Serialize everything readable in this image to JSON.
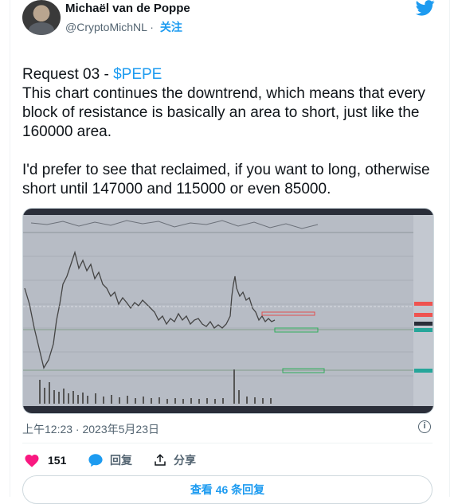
{
  "author": {
    "name": "Michaël van de Poppe",
    "handle": "@CryptoMichNL",
    "follow_label": "关注"
  },
  "tweet": {
    "line1_prefix": "Request 03 - ",
    "line1_cashtag": "$PEPE",
    "para2": "This chart continues the downtrend, which means that every block of resistance is basically an area to short, just like the 160000 area.",
    "para3": "I'd prefer to see that reclaimed, if you want to long, otherwise short until 147000 and 115000 or even 85000."
  },
  "meta": {
    "timestamp": "上午12:23 · 2023年5月23日",
    "info_label": "i"
  },
  "actions": {
    "likes": "151",
    "reply_label": "回复",
    "share_label": "分享"
  },
  "replies_button": "查看 46 条回复",
  "colors": {
    "accent": "#1d9bf0",
    "like": "#f91880",
    "candle_up": "#26a69a",
    "candle_down": "#ef5350"
  }
}
